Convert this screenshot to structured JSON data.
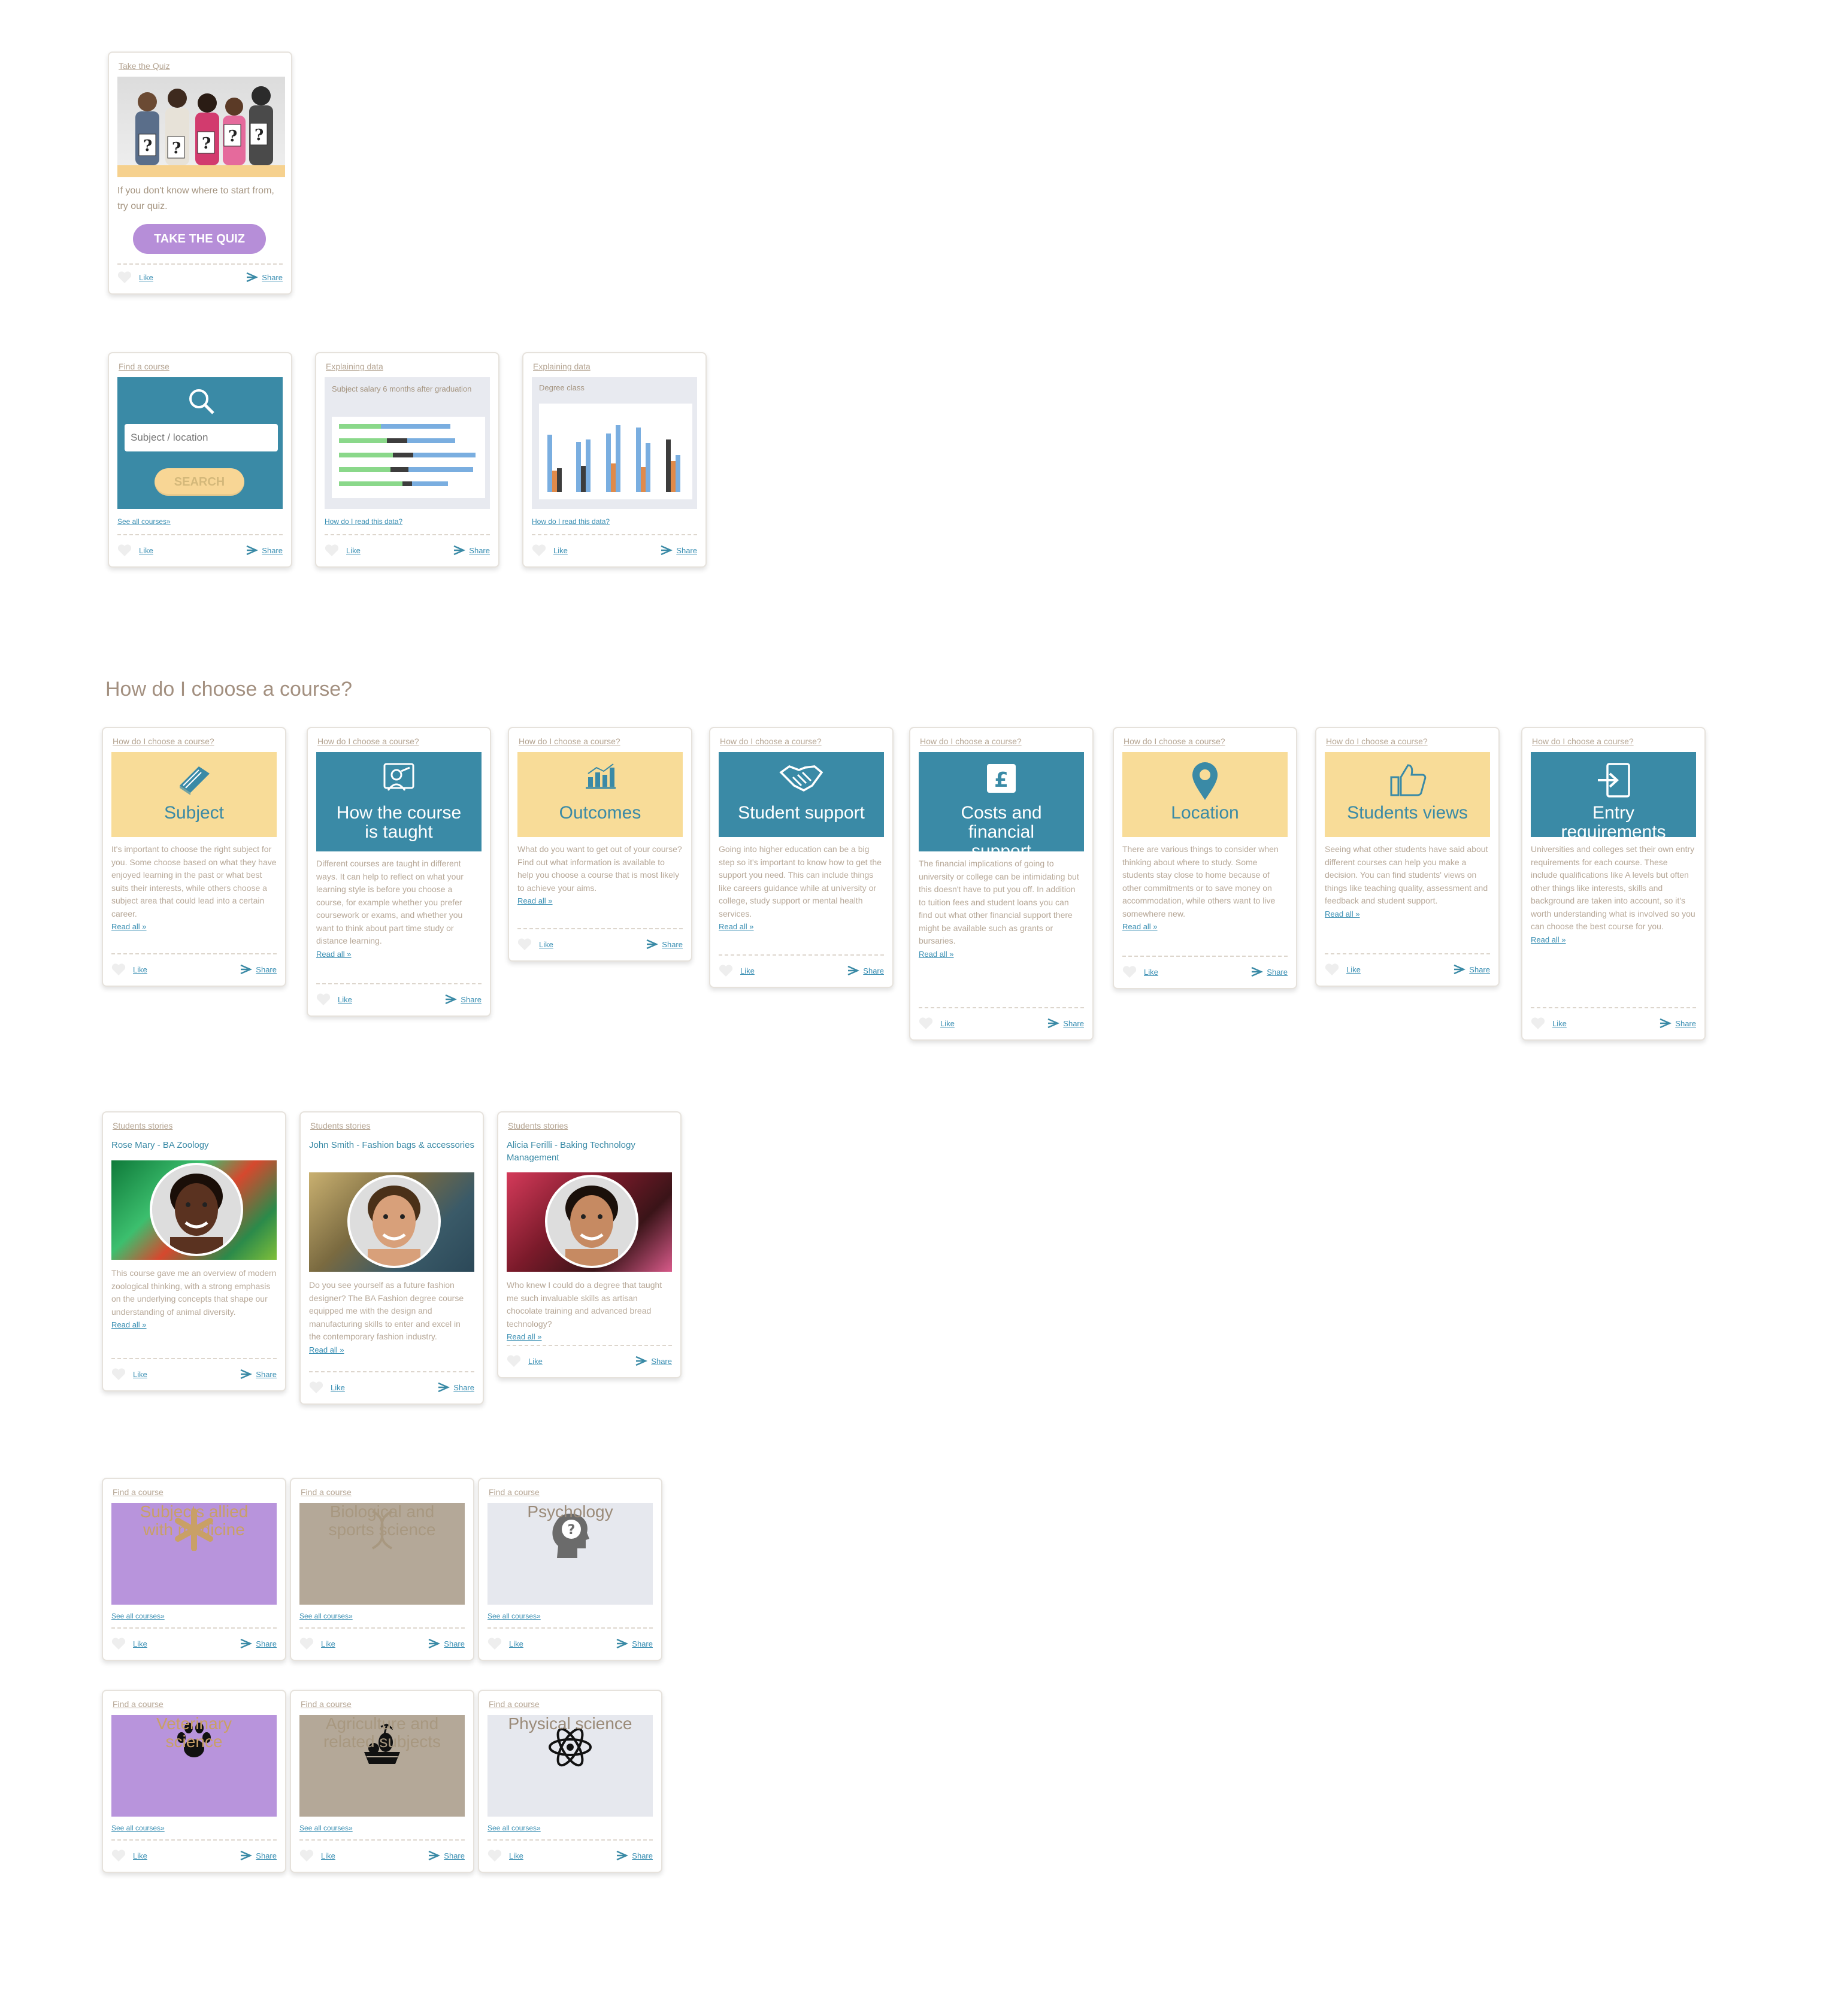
{
  "footer": {
    "like": "Like",
    "share": "Share"
  },
  "quiz": {
    "category": "Take the Quiz",
    "text": "If you don't know where to start from, try our quiz.",
    "button": "TAKE THE QUIZ"
  },
  "find_search": {
    "category": "Find a course",
    "placeholder": "Subject / location",
    "button": "SEARCH",
    "see_all": "See all courses»"
  },
  "salary": {
    "category": "Explaining data",
    "title": "Subject salary 6 months after graduation",
    "link": "How do I read this data?"
  },
  "degree": {
    "category": "Explaining data",
    "title": "Degree class",
    "link": "How do I read this data?"
  },
  "section_title": "How do I choose a course?",
  "choose_cards": [
    {
      "category": "How do I choose a course?",
      "title": "Subject",
      "icon": "book-icon",
      "style": "yellow",
      "body": "It's important to choose the right subject for you. Some choose based on what they have enjoyed learning in the past or what best suits their interests, while others choose a subject area that could lead into a certain career.",
      "read": "Read all »"
    },
    {
      "category": "How do I choose a course?",
      "title": "How the course is taught",
      "icon": "teacher-icon",
      "style": "teal",
      "body": "Different courses are taught in different ways. It can help to reflect on what your learning style is before you choose a course, for example whether you prefer coursework or exams, and whether you want to think about part time study or distance learning.",
      "read": "Read all »"
    },
    {
      "category": "How do I choose a course?",
      "title": "Outcomes",
      "icon": "bar-chart-icon",
      "style": "yellow",
      "body": "What do you want to get out of your course? Find out what information is available to help you choose a course that is most likely to achieve your aims.",
      "read": "Read all »"
    },
    {
      "category": "How do I choose a course?",
      "title": "Student support",
      "icon": "handshake-icon",
      "style": "teal",
      "body": "Going into higher education can be a big step so it's important to know how to get the support you need. This can include things like careers guidance while at university or college, study support or mental health services.",
      "read": "Read all »"
    },
    {
      "category": "How do I choose a course?",
      "title": "Costs and financial support",
      "icon": "pound-icon",
      "style": "teal",
      "body": "The financial implications of going to university or college can be intimidating but this doesn't have to put you off. In addition to tuition fees and student loans you can find out what other financial support there might be available such as grants or bursaries.",
      "read": "Read all »"
    },
    {
      "category": "How do I choose a course?",
      "title": "Location",
      "icon": "location-pin-icon",
      "style": "yellow",
      "body": "There are various things to consider when thinking about where to study. Some students stay close to home because of other commitments or to save money on accommodation, while others want to live somewhere new.",
      "read": "Read all »"
    },
    {
      "category": "How do I choose a course?",
      "title": "Students views",
      "icon": "thumbs-up-icon",
      "style": "yellow",
      "body": "Seeing what other students have said about different courses can help you make a decision. You can find students' views on things like teaching quality, assessment and feedback and student support.",
      "read": "Read all »"
    },
    {
      "category": "How do I choose a course?",
      "title": "Entry requirements",
      "icon": "sign-in-icon",
      "style": "teal",
      "body": "Universities and colleges set their own entry requirements for each course. These include qualifications like A levels but often other things like interests, skills and background are taken into account, so it's worth understanding what is involved so you can choose the best course for you.",
      "read": "Read all »"
    }
  ],
  "stories": [
    {
      "category": "Students stories",
      "name": "Rose Mary - BA Zoology",
      "body": "This course gave me an overview of modern zoological thinking, with a strong emphasis on the underlying concepts that shape our understanding of animal diversity.",
      "read": "Read all »"
    },
    {
      "category": "Students stories",
      "name": "John Smith - Fashion bags & accessories",
      "body": "Do you see yourself as a future fashion designer? The BA Fashion degree course equipped me with the design and manufacturing skills to enter and excel in the contemporary fashion industry.",
      "read": "Read all »"
    },
    {
      "category": "Students stories",
      "name": "Alicia Ferilli - Baking Technology Management",
      "body": "Who knew I could do a degree that taught me such invaluable skills as artisan chocolate training and advanced bread technology?",
      "read": "Read all »"
    }
  ],
  "subjects": [
    {
      "category": "Find a course",
      "title": "Subjects allied with medicine",
      "icon": "medical-icon",
      "bg": "#b894dc",
      "color": "#c9a066",
      "see_all": "See all courses»"
    },
    {
      "category": "Find a course",
      "title": "Biological and sports science",
      "icon": "dna-icon",
      "bg": "#b4a898",
      "color": "#a89880",
      "see_all": "See all courses»"
    },
    {
      "category": "Find a course",
      "title": "Psychology",
      "icon": "head-question-icon",
      "bg": "#e6e8ee",
      "color": "#9a8a78",
      "see_all": "See all courses»"
    },
    {
      "category": "Find a course",
      "title": "Veterinary science",
      "icon": "paw-icon",
      "bg": "#b894dc",
      "color": "#c9a066",
      "see_all": "See all courses»"
    },
    {
      "category": "Find a course",
      "title": "Agriculture and related subjects",
      "icon": "fruit-basket-icon",
      "bg": "#b4a898",
      "color": "#a89880",
      "see_all": "See all courses»"
    },
    {
      "category": "Find a course",
      "title": "Physical science",
      "icon": "atom-icon",
      "bg": "#e6e8ee",
      "color": "#9a8a78",
      "see_all": "See all courses»"
    }
  ],
  "colors": {
    "teal": "#3a8aa6",
    "yellow": "#f8dc98",
    "purple": "#b894dc",
    "link": "#3a8fb3"
  }
}
